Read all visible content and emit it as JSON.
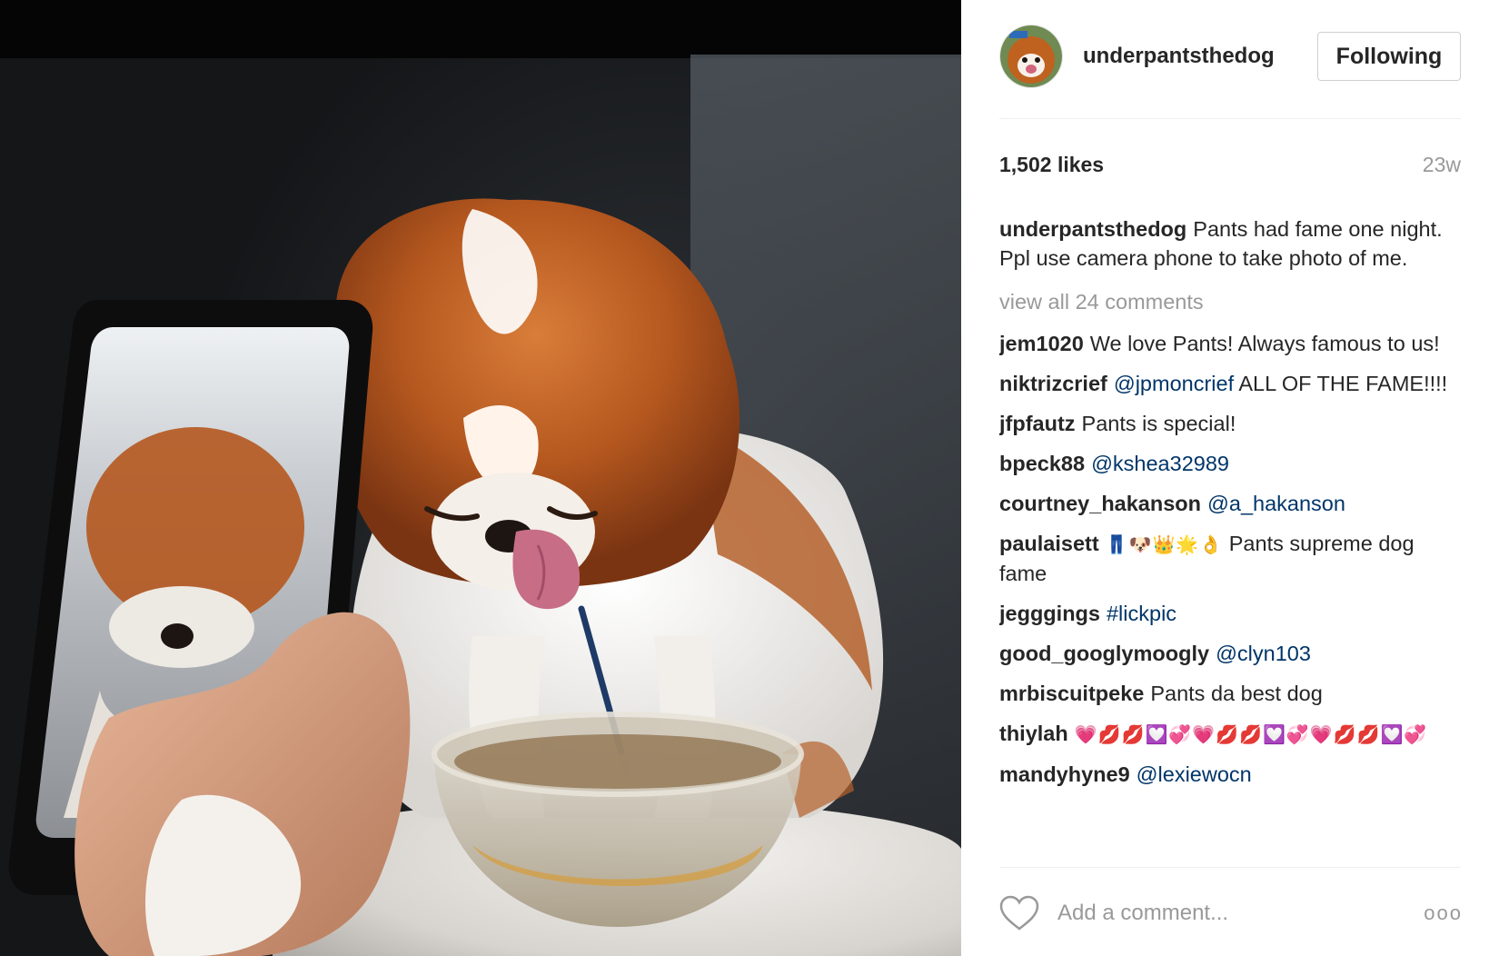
{
  "post": {
    "photo_alt": "",
    "author": {
      "username": "underpantsthedog",
      "follow_label": "Following"
    },
    "likes_label": "1,502 likes",
    "age": "23w",
    "caption": {
      "author": "underpantsthedog",
      "text": "Pants had fame one night. Ppl use camera phone to take photo of me."
    },
    "view_all_label": "view all 24 comments",
    "comments": [
      {
        "author": "jem1020",
        "mention": "",
        "text": "We love Pants! Always famous to us!",
        "emoji": ""
      },
      {
        "author": "niktrizcrief",
        "mention": "@jpmoncrief",
        "text": "ALL OF THE FAME!!!!",
        "emoji": ""
      },
      {
        "author": "jfpfautz",
        "mention": "",
        "text": "Pants is special!",
        "emoji": ""
      },
      {
        "author": "bpeck88",
        "mention": "@kshea32989",
        "text": "",
        "emoji": ""
      },
      {
        "author": "courtney_hakanson",
        "mention": "@a_hakanson",
        "text": "",
        "emoji": ""
      },
      {
        "author": "paulaisett",
        "mention": "",
        "emoji": "👖🐶👑🌟👌",
        "text": "Pants supreme dog fame"
      },
      {
        "author": "jegggings",
        "mention": "#lickpic",
        "text": "",
        "emoji": ""
      },
      {
        "author": "good_googlymoogly",
        "mention": "@clyn103",
        "text": "",
        "emoji": ""
      },
      {
        "author": "mrbiscuitpeke",
        "mention": "",
        "text": "Pants da best dog",
        "emoji": ""
      },
      {
        "author": "thiylah",
        "mention": "",
        "text": "",
        "emoji": "💗💋💋💟💞💗💋💋💟💞💗💋💋💟💞"
      },
      {
        "author": "mandyhyne9",
        "mention": "@lexiewocn",
        "text": "",
        "emoji": ""
      }
    ],
    "add_comment_placeholder": "Add a comment...",
    "more_label": "ooo",
    "icons": {
      "like": "heart-outline-icon",
      "more": "more-options-icon"
    },
    "colors": {
      "mention": "#003569",
      "muted": "#999999",
      "text": "#262626"
    }
  }
}
